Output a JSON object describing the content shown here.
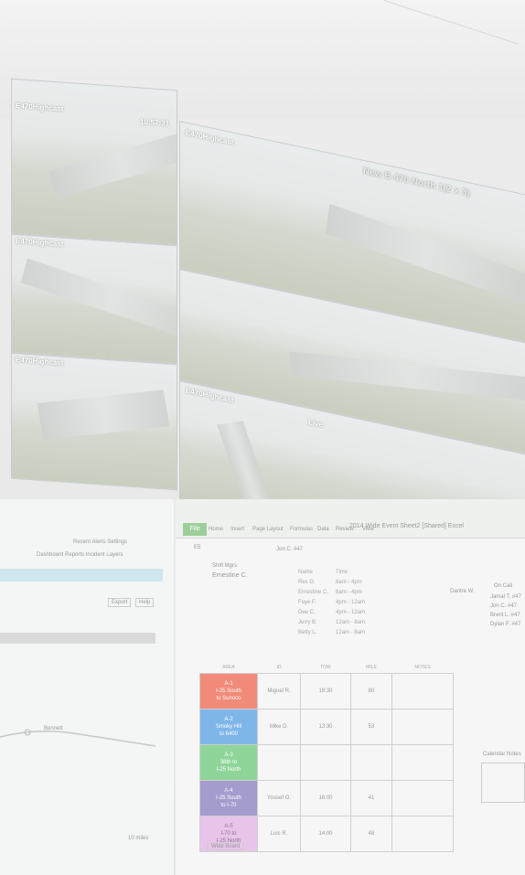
{
  "header": {
    "clock": "10:57:31",
    "big_title": "New E-470 North 1(2 x 3)",
    "status_live": "Live"
  },
  "cams": [
    {
      "name": "E470Highcast"
    },
    {
      "name": "E470Highcast"
    },
    {
      "name": "E470Highcast"
    },
    {
      "name": "E470Highcast"
    },
    {
      "name": "E470Highcast"
    }
  ],
  "left_panel": {
    "link_row": "Recent Alerts Settings",
    "tabs": "Dashboard  Reports  Incident  Layers",
    "export_btn": "Export",
    "help_btn": "Help",
    "road_label": "Bennett",
    "scale": "10 miles"
  },
  "spreadsheet": {
    "title": "2014 Wide Event Sheet2 [Shared] Excel",
    "file_tab": "File",
    "menu": [
      "Home",
      "Insert",
      "Page Layout",
      "Formulas",
      "Data",
      "Review",
      "View"
    ],
    "cell_ref": "E5",
    "formula": "Jon C. #47",
    "shift_header": "Shift Mgrs",
    "shift_name": "Ernestine C.",
    "roster_headers": [
      "Name",
      "Time"
    ],
    "roster": [
      [
        "Rex G.",
        "8am - 4pm"
      ],
      [
        "Ernestine C.",
        "8am - 4pm"
      ],
      [
        "Faye F.",
        "4pm - 12am"
      ],
      [
        "Dee C.",
        "4pm - 12am"
      ],
      [
        "Jerry B.",
        "12am - 8am"
      ],
      [
        "Betty L.",
        "12am - 8am"
      ]
    ],
    "right_name": "Dantre W.",
    "right_header": "On Call",
    "right_list": [
      "Jamal T. #47",
      "Jon C. #47",
      "Brent L. #47",
      "Dylan F. #47"
    ],
    "side_note": "Calendar Notes",
    "grid_headers": [
      "AREA",
      "ID",
      "TOW",
      "MILE",
      "NOTES"
    ],
    "rows": [
      {
        "area": "A-1\nI-25 South\nto Sunoco",
        "color": "#f18a79",
        "id": "Miguel R.",
        "tow": "18:30",
        "mile": "80",
        "notes": ""
      },
      {
        "area": "A-2\nSmoky Hill\nto 6400",
        "color": "#7fb6ea",
        "id": "Mike D.",
        "tow": "13:30",
        "mile": "53",
        "notes": ""
      },
      {
        "area": "A-3\n38th to\nI-25 North",
        "color": "#8fd59a",
        "id": "",
        "tow": "",
        "mile": "",
        "notes": ""
      },
      {
        "area": "A-4\nI-25 South\nto I-70",
        "color": "#a49ccd",
        "id": "Yousef O.",
        "tow": "16:00",
        "mile": "41",
        "notes": ""
      },
      {
        "area": "A-5\nI-70 to\nI-25 North",
        "color": "#e8c4ea",
        "id": "Luis R.",
        "tow": "14:00",
        "mile": "48",
        "notes": ""
      }
    ],
    "sheet_tab": "Wide Board"
  }
}
